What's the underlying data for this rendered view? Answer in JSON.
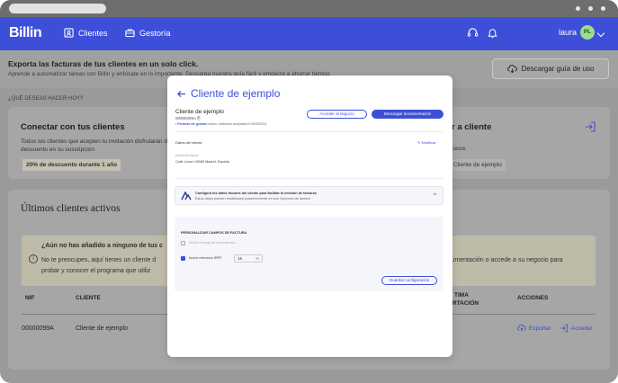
{
  "topbar": {
    "logo": "Billin",
    "nav_clients": "Clientes",
    "nav_gestoria": "Gestoría",
    "user_name": "laura",
    "avatar_initials": "PL"
  },
  "banner": {
    "title": "Exporta las facturas de tus clientes en un solo click.",
    "subtitle": "Aprende a automatizar tareas con Billin y enfócate en lo importante. Descarga nuestra guía fácil y empieza a ahorrar tiempo.",
    "button": "Descargar guía de uso"
  },
  "section_label": "¿QUÉ DESEAS HACER HOY?",
  "card_connect": {
    "title": "Conectar con tus clientes",
    "text": "Todos los clientes que acepten tu invitación disfrutarán de un descuento en su suscripción",
    "tag": "20% de descuento durante 1 año"
  },
  "card_access": {
    "title": "r a cliente",
    "text": "cesos",
    "tag": "Cliente de ejemplo"
  },
  "clients": {
    "title": "Últimos clientes activos",
    "alert_title": "¿Aún no has añadido a ninguno de tus c",
    "alert_line1": "No te preocupes, aquí tienes un cliente d",
    "alert_line2": "probar y conocer el programa que utiliz",
    "alert_right": "cumentación o accede a su negocio para",
    "col_nif": "NIF",
    "col_cliente": "CLIENTE",
    "col_ult_1": "TIMA",
    "col_ult_2": "RTACIÓN",
    "col_acciones": "ACCIONES",
    "row_nif": "00000099A",
    "row_cliente": "Cliente de ejemplo",
    "action_export": "Exportar",
    "action_access": "Acceder"
  },
  "modal": {
    "title": "Cliente de ejemplo",
    "client_name": "Cliente de ejemplo",
    "nif": "00000099A",
    "status_highlight": "• Permiso de gestión",
    "status_rest": " activo, invitación aceptada el 09/05/2024",
    "btn_access": "Acceder al negocio",
    "btn_download": "Descargar documentación",
    "client_data_label": "Datos del cliente",
    "edit": "Modificar",
    "address_label": "Dirección fiscal",
    "address": "Calle Lorem 28080 Madrid, España",
    "fiscal_title": "Configura los datos fiscales del cliente para facilitar la emisión de facturas",
    "fiscal_sub": "Estos datos pueden modificarse posteriormente en sus Opciones de factura",
    "custom_title": "PERSONALIZAR CAMPOS DE FACTURA",
    "opt_recargo": "Incluir recargo de equivalencia",
    "opt_irpf": "Incluir retención IRPF",
    "irpf_value": "15",
    "irpf_unit": "%",
    "save_btn": "Guardar configuración"
  }
}
